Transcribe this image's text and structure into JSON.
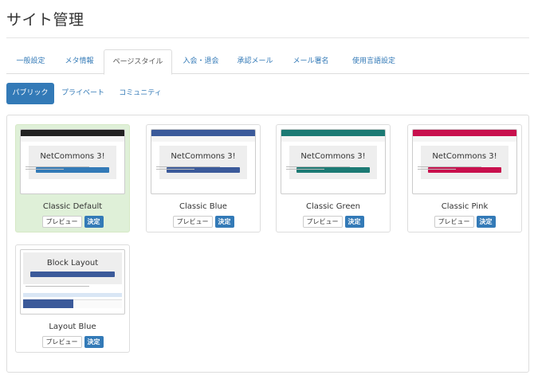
{
  "page": {
    "title": "サイト管理"
  },
  "main_tabs": [
    {
      "label": "一般設定"
    },
    {
      "label": "メタ情報"
    },
    {
      "label": "ページスタイル"
    },
    {
      "label": "入会・退会"
    },
    {
      "label": "承認メール"
    },
    {
      "label": "メール署名"
    },
    {
      "label": "使用言語設定"
    }
  ],
  "sub_tabs": [
    {
      "label": "パブリック"
    },
    {
      "label": "プライベート"
    },
    {
      "label": "コミュニティ"
    }
  ],
  "buttons": {
    "preview": "プレビュー",
    "decide": "決定"
  },
  "themes": [
    {
      "name": "Classic Default",
      "thumb_heading": "NetCommons 3!",
      "nav_color": "#222222",
      "accent": "#337ab7"
    },
    {
      "name": "Classic Blue",
      "thumb_heading": "NetCommons 3!",
      "nav_color": "#3b5a9a",
      "accent": "#3b5a9a"
    },
    {
      "name": "Classic Green",
      "thumb_heading": "NetCommons 3!",
      "nav_color": "#1c7a74",
      "accent": "#1c7a74"
    },
    {
      "name": "Classic Pink",
      "thumb_heading": "NetCommons 3!",
      "nav_color": "#c8104d",
      "accent": "#c8104d"
    },
    {
      "name": "Layout Blue",
      "thumb_heading": "Block Layout",
      "nav_color": "#3b5a9a",
      "accent": "#3b5a9a"
    }
  ],
  "colors": {
    "primary": "#337ab7",
    "selected_bg": "#dff0d8"
  }
}
